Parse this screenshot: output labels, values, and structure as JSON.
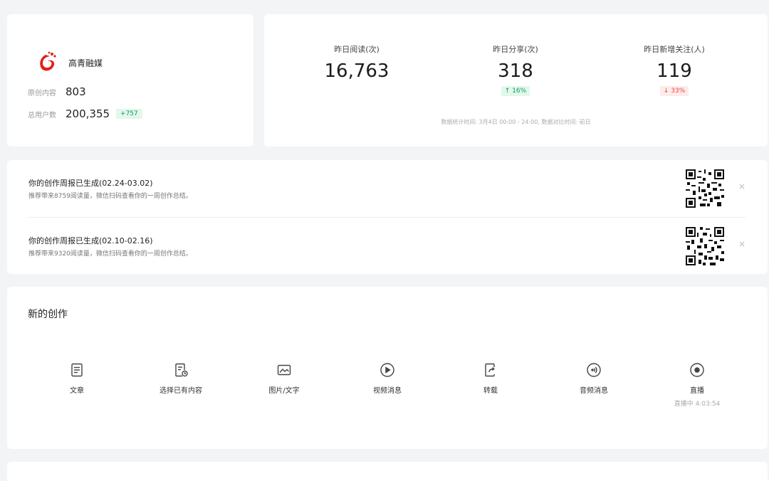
{
  "account": {
    "name": "高青融媒",
    "logo_color": "#e0201b",
    "original_label": "原创内容",
    "original_value": "803",
    "users_label": "总用户数",
    "users_value": "200,355",
    "users_change": "+757"
  },
  "stats": {
    "items": [
      {
        "label": "昨日阅读(次)",
        "value": "16,763",
        "change": ""
      },
      {
        "label": "昨日分享(次)",
        "value": "318",
        "change": "↑ 16%",
        "direction": "up"
      },
      {
        "label": "昨日新增关注(人)",
        "value": "119",
        "change": "↓ 33%",
        "direction": "down"
      }
    ],
    "note": "数据统计时间: 3月4日 00:00 - 24:00, 数据对比时间: 前日"
  },
  "reports": [
    {
      "title": "你的创作周报已生成(02.24-03.02)",
      "desc": "推荐带来8759阅读量，微信扫码查看你的一周创作总结。",
      "close": "×"
    },
    {
      "title": "你的创作周报已生成(02.10-02.16)",
      "desc": "推荐带来9320阅读量，微信扫码查看你的一周创作总结。",
      "close": "×"
    }
  ],
  "create": {
    "title": "新的创作",
    "tools": [
      {
        "label": "文章",
        "icon": "article-icon"
      },
      {
        "label": "选择已有内容",
        "icon": "existing-content-icon"
      },
      {
        "label": "图片/文字",
        "icon": "image-text-icon"
      },
      {
        "label": "视频消息",
        "icon": "video-icon"
      },
      {
        "label": "转载",
        "icon": "repost-icon"
      },
      {
        "label": "音频消息",
        "icon": "audio-icon"
      },
      {
        "label": "直播",
        "icon": "live-icon",
        "sub": "直播中 4:03:54"
      }
    ]
  }
}
